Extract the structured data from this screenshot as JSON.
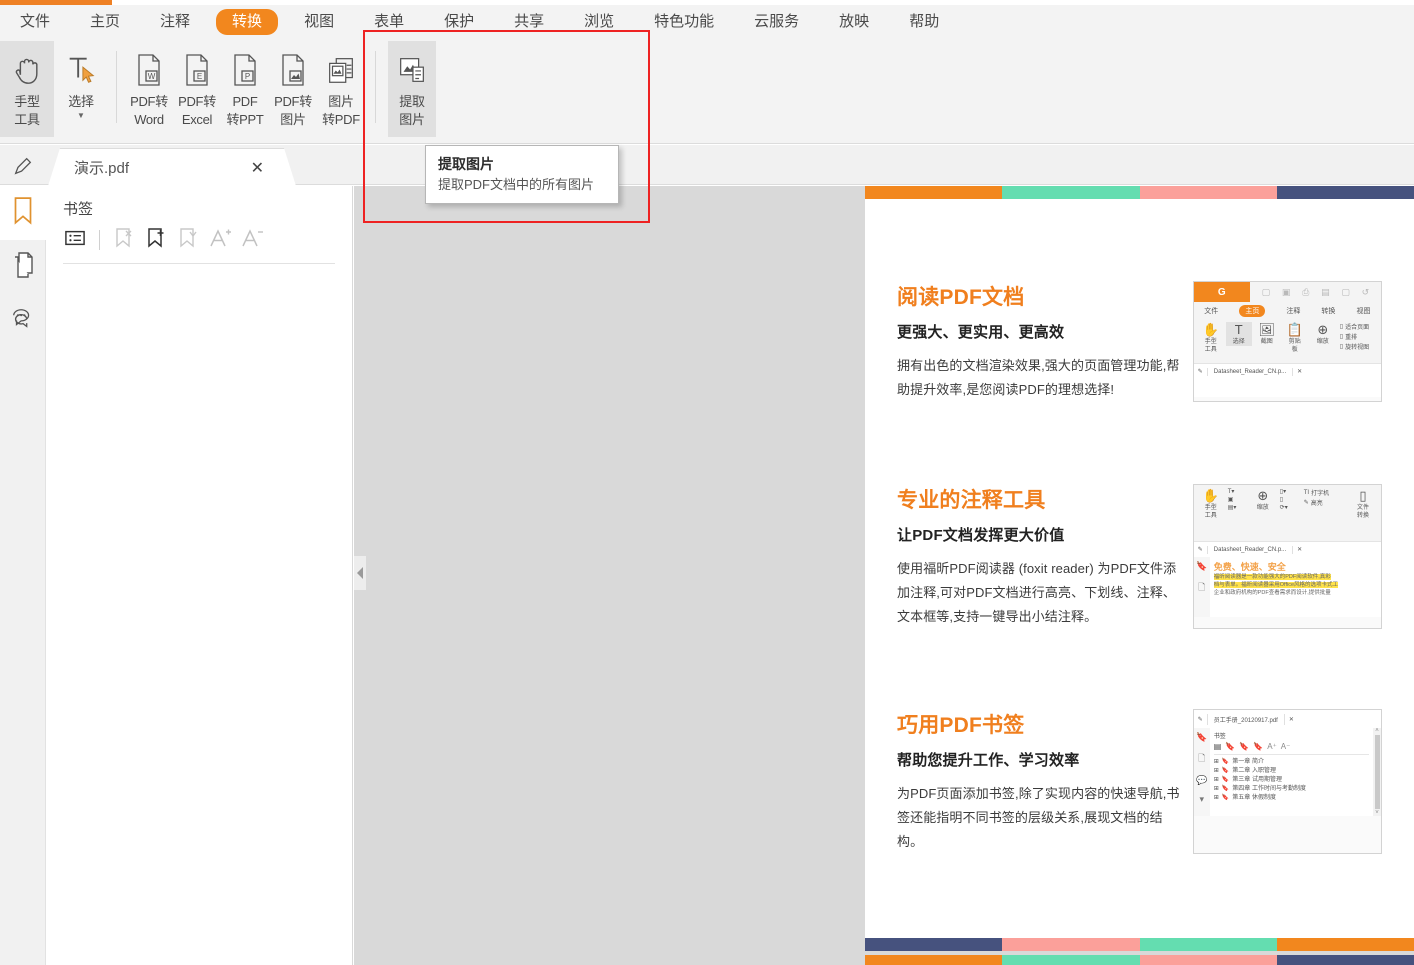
{
  "app": {
    "accent_orange": "#f2871e",
    "highlight_red": "#ee2222"
  },
  "menubar": {
    "items": [
      {
        "label": "文件",
        "active": false
      },
      {
        "label": "主页",
        "active": false
      },
      {
        "label": "注释",
        "active": false
      },
      {
        "label": "转换",
        "active": true
      },
      {
        "label": "视图",
        "active": false
      },
      {
        "label": "表单",
        "active": false
      },
      {
        "label": "保护",
        "active": false
      },
      {
        "label": "共享",
        "active": false
      },
      {
        "label": "浏览",
        "active": false
      },
      {
        "label": "特色功能",
        "active": false
      },
      {
        "label": "云服务",
        "active": false
      },
      {
        "label": "放映",
        "active": false
      },
      {
        "label": "帮助",
        "active": false
      }
    ]
  },
  "ribbon": {
    "buttons": [
      {
        "name": "hand-tool",
        "line1": "手型",
        "line2": "工具",
        "icon": "hand-icon",
        "selected": true,
        "caret": false
      },
      {
        "name": "select-tool",
        "line1": "选择",
        "line2": "",
        "icon": "text-select-icon",
        "selected": false,
        "caret": true
      },
      {
        "name": "pdf-to-word",
        "line1": "PDF转",
        "line2": "Word",
        "icon": "doc-word-icon",
        "selected": false,
        "caret": false
      },
      {
        "name": "pdf-to-excel",
        "line1": "PDF转",
        "line2": "Excel",
        "icon": "doc-excel-icon",
        "selected": false,
        "caret": false
      },
      {
        "name": "pdf-to-ppt",
        "line1": "PDF",
        "line2": "转PPT",
        "icon": "doc-ppt-icon",
        "selected": false,
        "caret": false
      },
      {
        "name": "pdf-to-image",
        "line1": "PDF转",
        "line2": "图片",
        "icon": "doc-image-icon",
        "selected": false,
        "caret": false
      },
      {
        "name": "image-to-pdf",
        "line1": "图片",
        "line2": "转PDF",
        "icon": "images-to-doc-icon",
        "selected": false,
        "caret": false
      },
      {
        "name": "extract-images",
        "line1": "提取",
        "line2": "图片",
        "icon": "extract-image-icon",
        "selected": true,
        "caret": false
      }
    ]
  },
  "tooltip": {
    "title": "提取图片",
    "description": "提取PDF文档中的所有图片"
  },
  "tabstrip": {
    "document_tab": "演示.pdf",
    "close_label": "✕"
  },
  "rail": {
    "items": [
      {
        "name": "bookmark",
        "icon": "bookmark-icon",
        "active": true
      },
      {
        "name": "pages",
        "icon": "pages-icon",
        "active": false
      },
      {
        "name": "comments",
        "icon": "comment-icon",
        "active": false
      }
    ]
  },
  "bookmark_panel": {
    "title": "书签",
    "tools": [
      {
        "name": "list-view",
        "icon": "list-icon"
      },
      {
        "name": "delete-bookmark",
        "icon": "bookmark-delete-icon"
      },
      {
        "name": "add-bookmark",
        "icon": "bookmark-add-icon"
      },
      {
        "name": "bookmark-options",
        "icon": "bookmark-dropdown-icon"
      },
      {
        "name": "increase-font",
        "icon": "font-increase-icon"
      },
      {
        "name": "decrease-font",
        "icon": "font-decrease-icon"
      }
    ]
  },
  "document": {
    "top_bar_colors": [
      "#f2871e",
      "#64ddb0",
      "#fba09a",
      "#46527e"
    ],
    "bottom_bar_colors": [
      "#46527e",
      "#fba09a",
      "#64ddb0",
      "#f2871e"
    ],
    "page2_bar_colors": [
      "#f2871e",
      "#64ddb0",
      "#fba09a",
      "#46527e"
    ],
    "sections": [
      {
        "heading": "阅读PDF文档",
        "subheading": "更强大、更实用、更高效",
        "body": "拥有出色的文档渲染效果,强大的页面管理功能,帮助提升效率,是您阅读PDF的理想选择!",
        "mini": {
          "type": "reader-home",
          "logo": "G",
          "menu": [
            "文件",
            "主页",
            "注释",
            "转换",
            "视图"
          ],
          "menu_active": "主页",
          "tools": [
            {
              "line1": "手型",
              "line2": "工具",
              "glyph": "✋"
            },
            {
              "line1": "选择",
              "line2": "",
              "glyph": "T"
            },
            {
              "line1": "截图",
              "line2": "",
              "glyph": "🖼"
            },
            {
              "line1": "剪贴",
              "line2": "板",
              "glyph": "📋"
            },
            {
              "line1": "缩放",
              "line2": "",
              "glyph": "⊕"
            }
          ],
          "right_items": [
            "适合页面",
            "重排",
            "旋转视图"
          ],
          "tab": "Datasheet_Reader_CN.p..."
        }
      },
      {
        "heading": "专业的注释工具",
        "subheading": "让PDF文档发挥更大价值",
        "body": "使用福昕PDF阅读器 (foxit reader) 为PDF文件添加注释,可对PDF文档进行高亮、下划线、注释、文本框等,支持一键导出小结注释。",
        "mini": {
          "type": "reader-annotate",
          "tools": [
            {
              "line1": "手型",
              "line2": "工具",
              "glyph": "✋"
            },
            {
              "line1": "缩放",
              "line2": "",
              "glyph": "⊕"
            }
          ],
          "right_items": [
            "打字机",
            "高亮"
          ],
          "right_last": {
            "line1": "文件",
            "line2": "转换"
          },
          "tab": "Datasheet_Reader_CN.p...",
          "content_heading": "免费、快速、安全",
          "content_lines": [
            "福昕阅读器是一款功能强大的PDF阅读软件,真彩",
            "档与表单。福昕阅读器采用Office风格的选项卡式工",
            "企业和政府机构的PDF查看需求而设计,提供批量"
          ]
        }
      },
      {
        "heading": "巧用PDF书签",
        "subheading": "帮助您提升工作、学习效率",
        "body": "为PDF页面添加书签,除了实现内容的快速导航,书签还能指明不同书签的层级关系,展现文档的结构。",
        "mini": {
          "type": "reader-bookmarks",
          "tab": "员工手册_20120917.pdf",
          "panel_title": "书签",
          "bookmarks": [
            "第一章  简介",
            "第二章  入职管理",
            "第三章  试用期管理",
            "第四章  工作时间与考勤制度",
            "第五章  休假制度"
          ]
        }
      }
    ]
  }
}
